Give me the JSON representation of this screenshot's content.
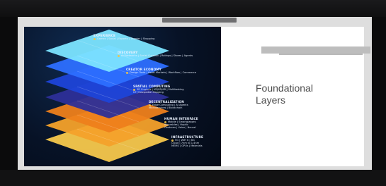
{
  "slide": {
    "title": "Foundational\nLayers",
    "layers": [
      {
        "title": "EXPERIENCE",
        "items": "Games | Social | Esports | Theater | Shopping"
      },
      {
        "title": "DISCOVERY",
        "items": "Ad Networks | Social Curation | Ratings | Stores | Agents"
      },
      {
        "title": "CREATOR ECONOMY",
        "items": "Design Tools | Asset Markets | Workflow | Commerce"
      },
      {
        "title": "SPATIAL COMPUTING",
        "items": "3D Engines | VR/XR/AR | Multitasking\nUI | Geospatial Mapping"
      },
      {
        "title": "DECENTRALIZATION",
        "items": "Edge Computing | AI Agents\nMicroservices | Blockchain"
      },
      {
        "title": "HUMAN INTERFACE",
        "items": "Mobile | Smartglasses\nWearables | Haptic\nGestures | Voice | Neural"
      },
      {
        "title": "INFRASTRUCTURE",
        "items": "5G | WiFi 6 | 6G\nCloud | 7nm to 1.4nm\nMEMS | GPUs | Materials"
      }
    ],
    "layer_colors": [
      "#7fe6ff",
      "#2a6bff",
      "#1d3fd9",
      "#2a2f9b",
      "#f08a1c",
      "#f6b429",
      "#f6c74a"
    ]
  }
}
